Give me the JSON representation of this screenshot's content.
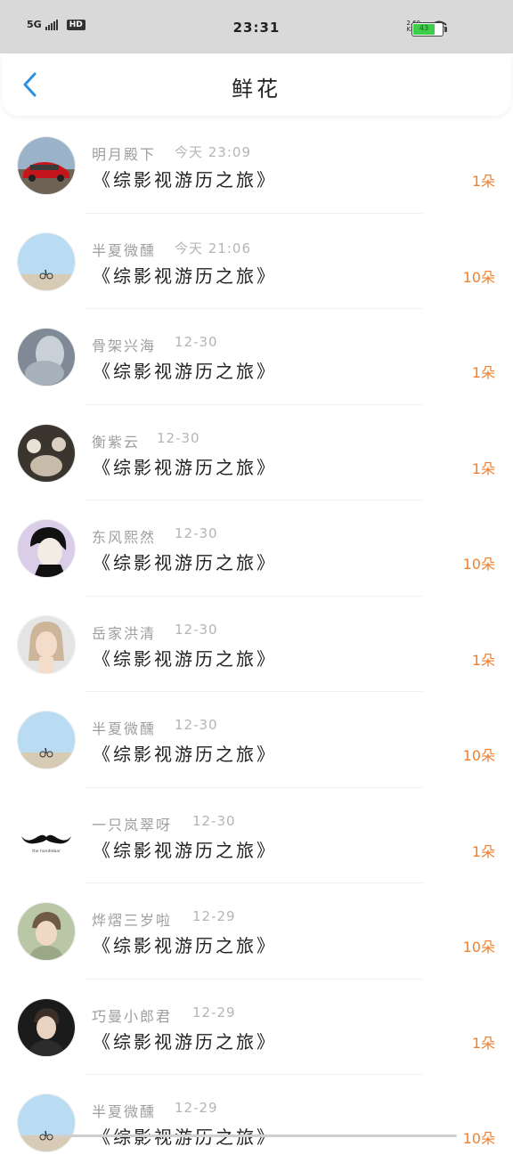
{
  "status_bar": {
    "network": "5G",
    "hd": "HD",
    "time": "23:31",
    "speed_value": "2.60",
    "speed_unit": "KB/s",
    "battery": "43"
  },
  "header": {
    "title": "鲜花"
  },
  "rows": [
    {
      "name": "明月殿下",
      "date": "今天 23:09",
      "book": "《综影视游历之旅》",
      "count": "1朵"
    },
    {
      "name": "半夏微醺",
      "date": "今天 21:06",
      "book": "《综影视游历之旅》",
      "count": "10朵"
    },
    {
      "name": "骨架兴海",
      "date": "12-30",
      "book": "《综影视游历之旅》",
      "count": "1朵"
    },
    {
      "name": "衡紫云",
      "date": "12-30",
      "book": "《综影视游历之旅》",
      "count": "1朵"
    },
    {
      "name": "东风熙然",
      "date": "12-30",
      "book": "《综影视游历之旅》",
      "count": "10朵"
    },
    {
      "name": "岳家洪清",
      "date": "12-30",
      "book": "《综影视游历之旅》",
      "count": "1朵"
    },
    {
      "name": "半夏微醺",
      "date": "12-30",
      "book": "《综影视游历之旅》",
      "count": "10朵"
    },
    {
      "name": "一只岚翠呀",
      "date": "12-30",
      "book": "《综影视游历之旅》",
      "count": "1朵"
    },
    {
      "name": "烨熠三岁啦",
      "date": "12-29",
      "book": "《综影视游历之旅》",
      "count": "10朵"
    },
    {
      "name": "巧曼小郎君",
      "date": "12-29",
      "book": "《综影视游历之旅》",
      "count": "1朵"
    },
    {
      "name": "半夏微醺",
      "date": "12-29",
      "book": "《综影视游历之旅》",
      "count": "10朵"
    }
  ],
  "mustache_caption": "the handlebar"
}
